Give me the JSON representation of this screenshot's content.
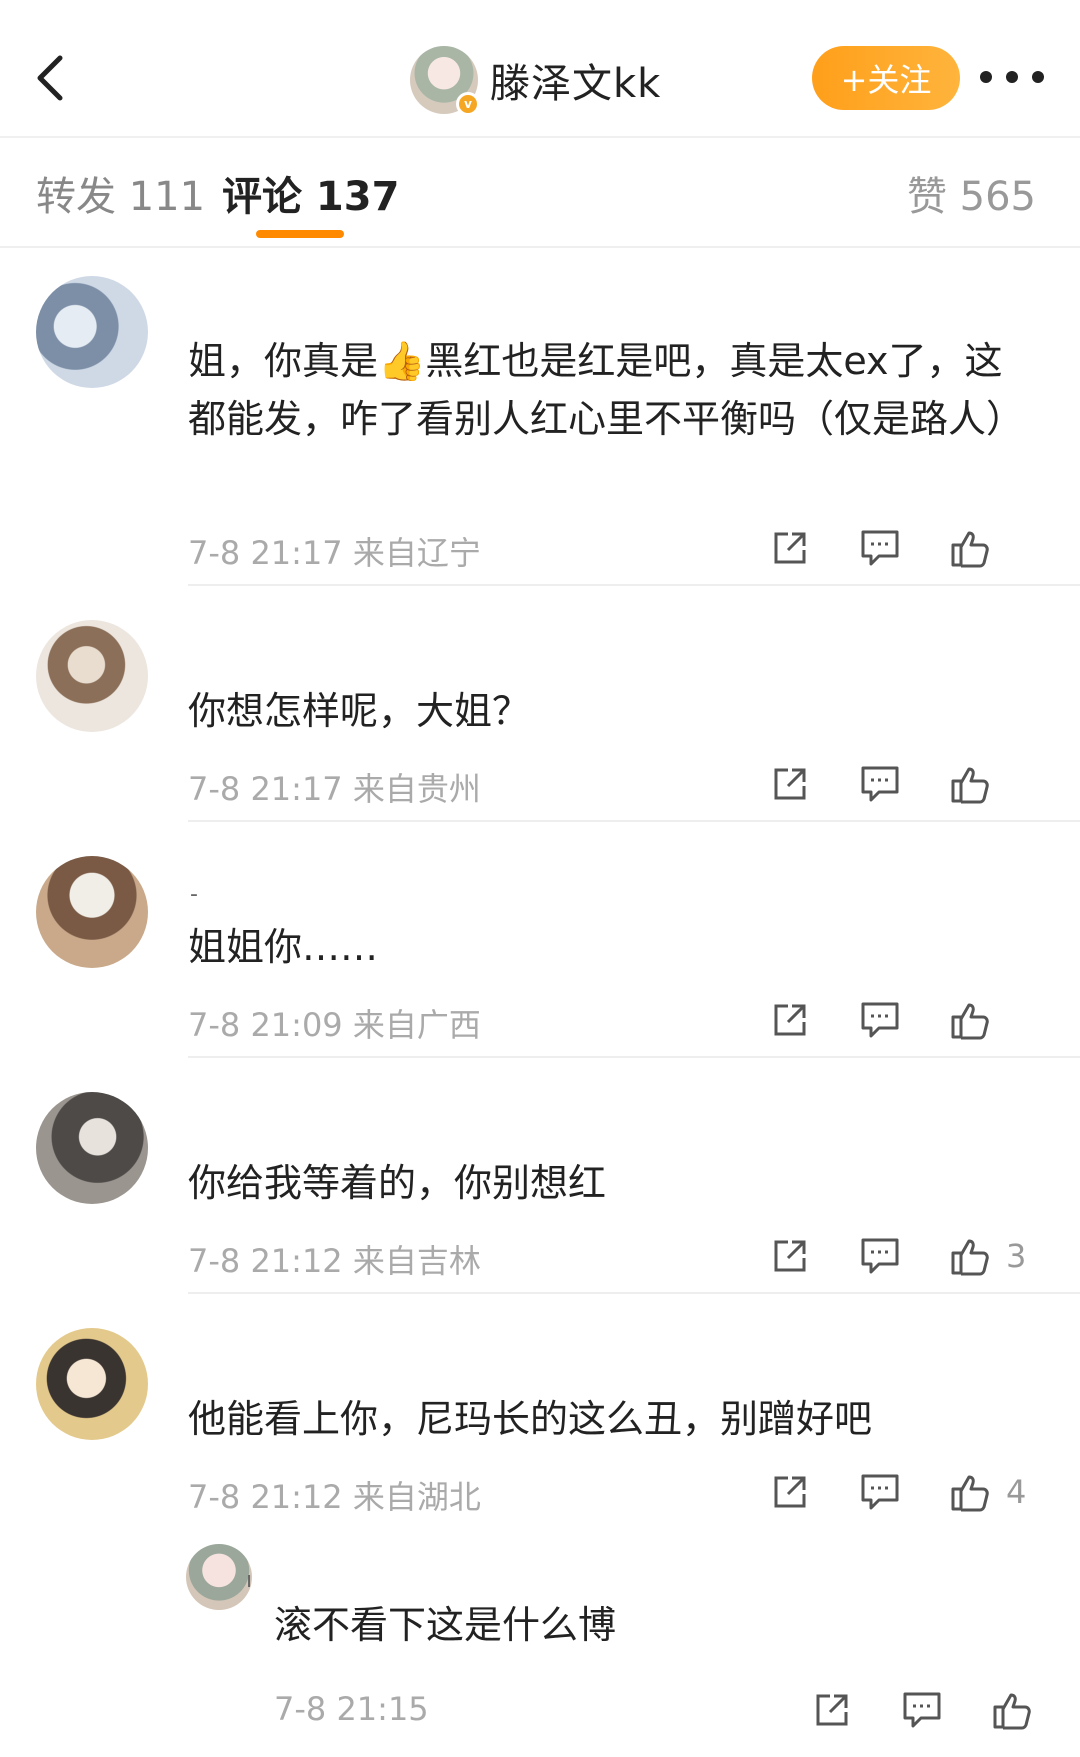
{
  "header": {
    "username": "滕泽文kk",
    "follow_label": "+关注",
    "verified_mark": "v"
  },
  "tabs": {
    "repost_label": "转发 111",
    "comment_label": "评论 137",
    "like_label": "赞 565"
  },
  "colors": {
    "accent": "#ff9f1a",
    "meta": "#aaaaaa",
    "divider": "#eeeeee"
  },
  "comments": [
    {
      "text": "姐，你真是👍黑红也是红是吧，真是太ex了，这都能发，咋了看别人红心里不平衡吗（仅是路人）",
      "meta": "7-8 21:17 来自辽宁",
      "likes": ""
    },
    {
      "text": "你想怎样呢，大姐？",
      "meta": "7-8 21:17 来自贵州",
      "likes": ""
    },
    {
      "mark": "-",
      "text": "姐姐你……",
      "meta": "7-8 21:09 来自广西",
      "likes": ""
    },
    {
      "text": "你给我等着的，你别想红",
      "meta": "7-8 21:12 来自吉林",
      "likes": "3"
    },
    {
      "text": "他能看上你，尼玛长的这么丑，别蹭好吧",
      "meta": "7-8 21:12 来自湖北",
      "likes": "4"
    }
  ],
  "reply": {
    "mark": "ı",
    "text": "滚不看下这是什么博",
    "meta": "7-8 21:15"
  }
}
